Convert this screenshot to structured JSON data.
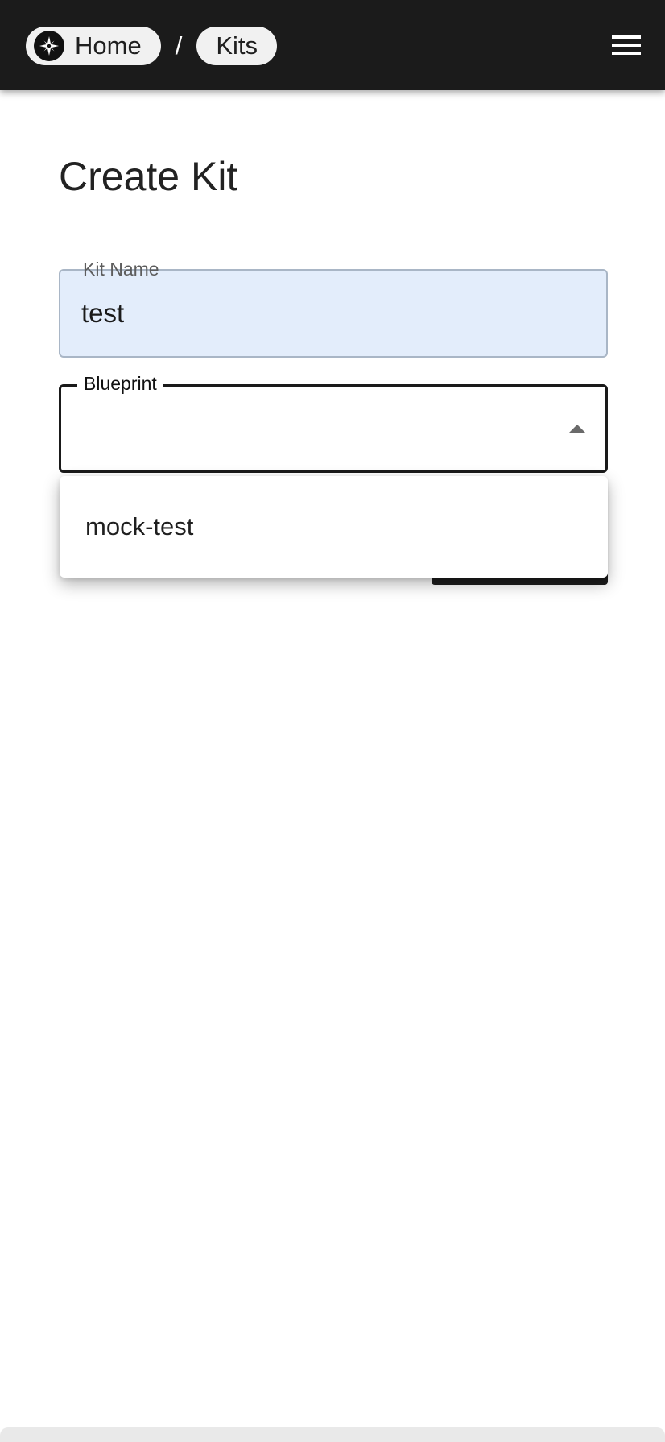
{
  "breadcrumb": {
    "home_label": "Home",
    "separator": "/",
    "kits_label": "Kits"
  },
  "page": {
    "title": "Create Kit"
  },
  "form": {
    "kit_name": {
      "label": "Kit Name",
      "value": "test"
    },
    "blueprint": {
      "label": "Blueprint",
      "selected": "",
      "options": [
        "mock-test"
      ]
    }
  },
  "icons": {
    "logo": "compass-star-icon",
    "menu": "hamburger-menu-icon",
    "caret": "caret-up-icon"
  },
  "colors": {
    "topbar": "#1b1b1b",
    "chip": "#f1f1f1",
    "input_fill": "#e3edfb"
  }
}
